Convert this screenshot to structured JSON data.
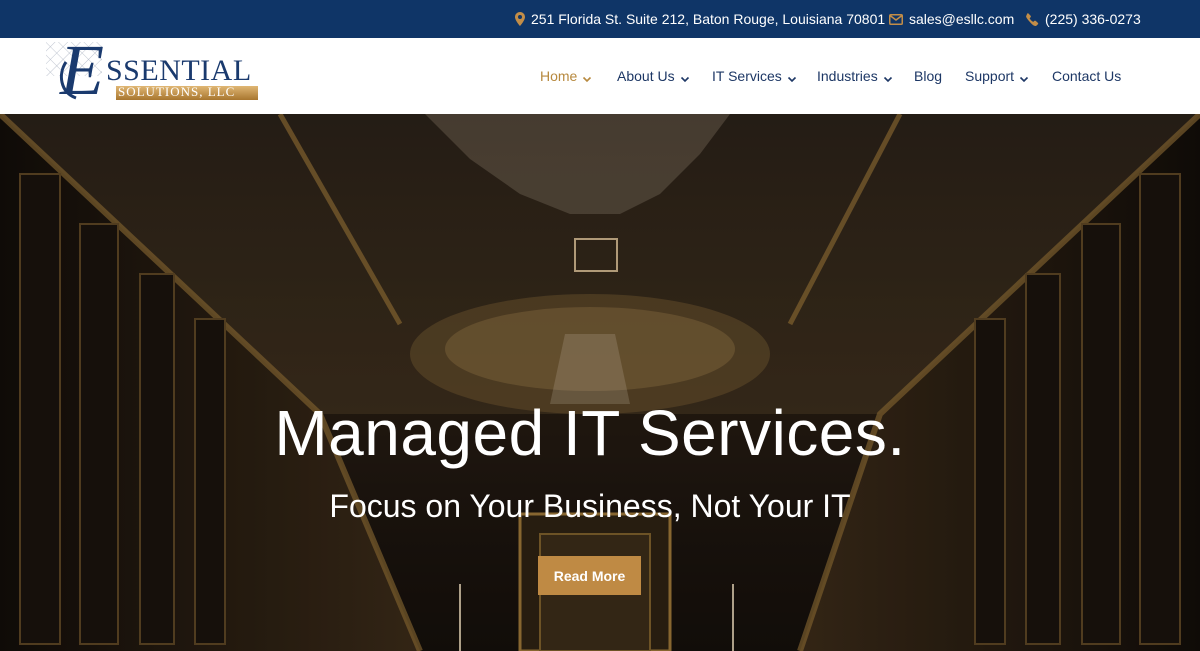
{
  "topbar": {
    "address": "251 Florida St. Suite 212, Baton Rouge, Louisiana 70801",
    "email": "sales@esllc.com",
    "phone": "(225) 336-0273"
  },
  "logo": {
    "wordmark": "SSENTIAL",
    "initial": "E",
    "tagline": "SOLUTIONS, LLC"
  },
  "nav": {
    "items": [
      {
        "label": "Home",
        "active": true,
        "dropdown": true
      },
      {
        "label": "About Us",
        "active": false,
        "dropdown": true
      },
      {
        "label": "IT Services",
        "active": false,
        "dropdown": true
      },
      {
        "label": "Industries",
        "active": false,
        "dropdown": true
      },
      {
        "label": "Blog",
        "active": false,
        "dropdown": false
      },
      {
        "label": "Support",
        "active": false,
        "dropdown": true
      },
      {
        "label": "Contact Us",
        "active": false,
        "dropdown": false
      }
    ]
  },
  "hero": {
    "title": "Managed IT Services.",
    "subtitle": "Focus on Your Business, Not Your IT",
    "cta_label": "Read More"
  },
  "colors": {
    "topbar_bg": "#0f3567",
    "nav_text": "#1d3765",
    "accent": "#b7893e",
    "button": "#bf8a44"
  },
  "icons": {
    "address": "map-pin-icon",
    "email": "envelope-icon",
    "phone": "phone-icon",
    "dropdown": "chevron-down-icon"
  }
}
